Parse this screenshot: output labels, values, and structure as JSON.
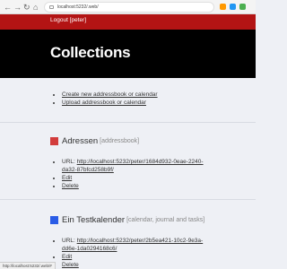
{
  "browser": {
    "back": "←",
    "forward": "→",
    "reload": "↻",
    "home": "⌂",
    "url": "localhost:5232/.web/",
    "ext_colors": [
      "#ff9800",
      "#2196f3",
      "#4caf50"
    ]
  },
  "header": {
    "logout": "Logout [peter]"
  },
  "page": {
    "title": "Collections"
  },
  "actions": {
    "create": "Create new addressbook or calendar",
    "upload": "Upload addressbook or calendar"
  },
  "collections": [
    {
      "color": "#d23c3c",
      "name": "Adressen",
      "type": "[addressbook]",
      "url_label": "URL:",
      "url_line1": "http://localhost:5232/peter/1684d932-0eae-2240-",
      "url_line2": "da32-87bfcd258b9f/",
      "edit": "Edit",
      "delete": "Delete"
    },
    {
      "color": "#2a5ce6",
      "name": "Ein Testkalender",
      "type": "[calendar, journal and tasks]",
      "url_label": "URL:",
      "url_line1": "http://localhost:5232/peter/2b5ea421-10c2-9e3a-",
      "url_line2": "dd6e-1da0294168c6/",
      "edit": "Edit",
      "delete": "Delete"
    }
  ],
  "status": "http://localhost:5232/.web/#"
}
